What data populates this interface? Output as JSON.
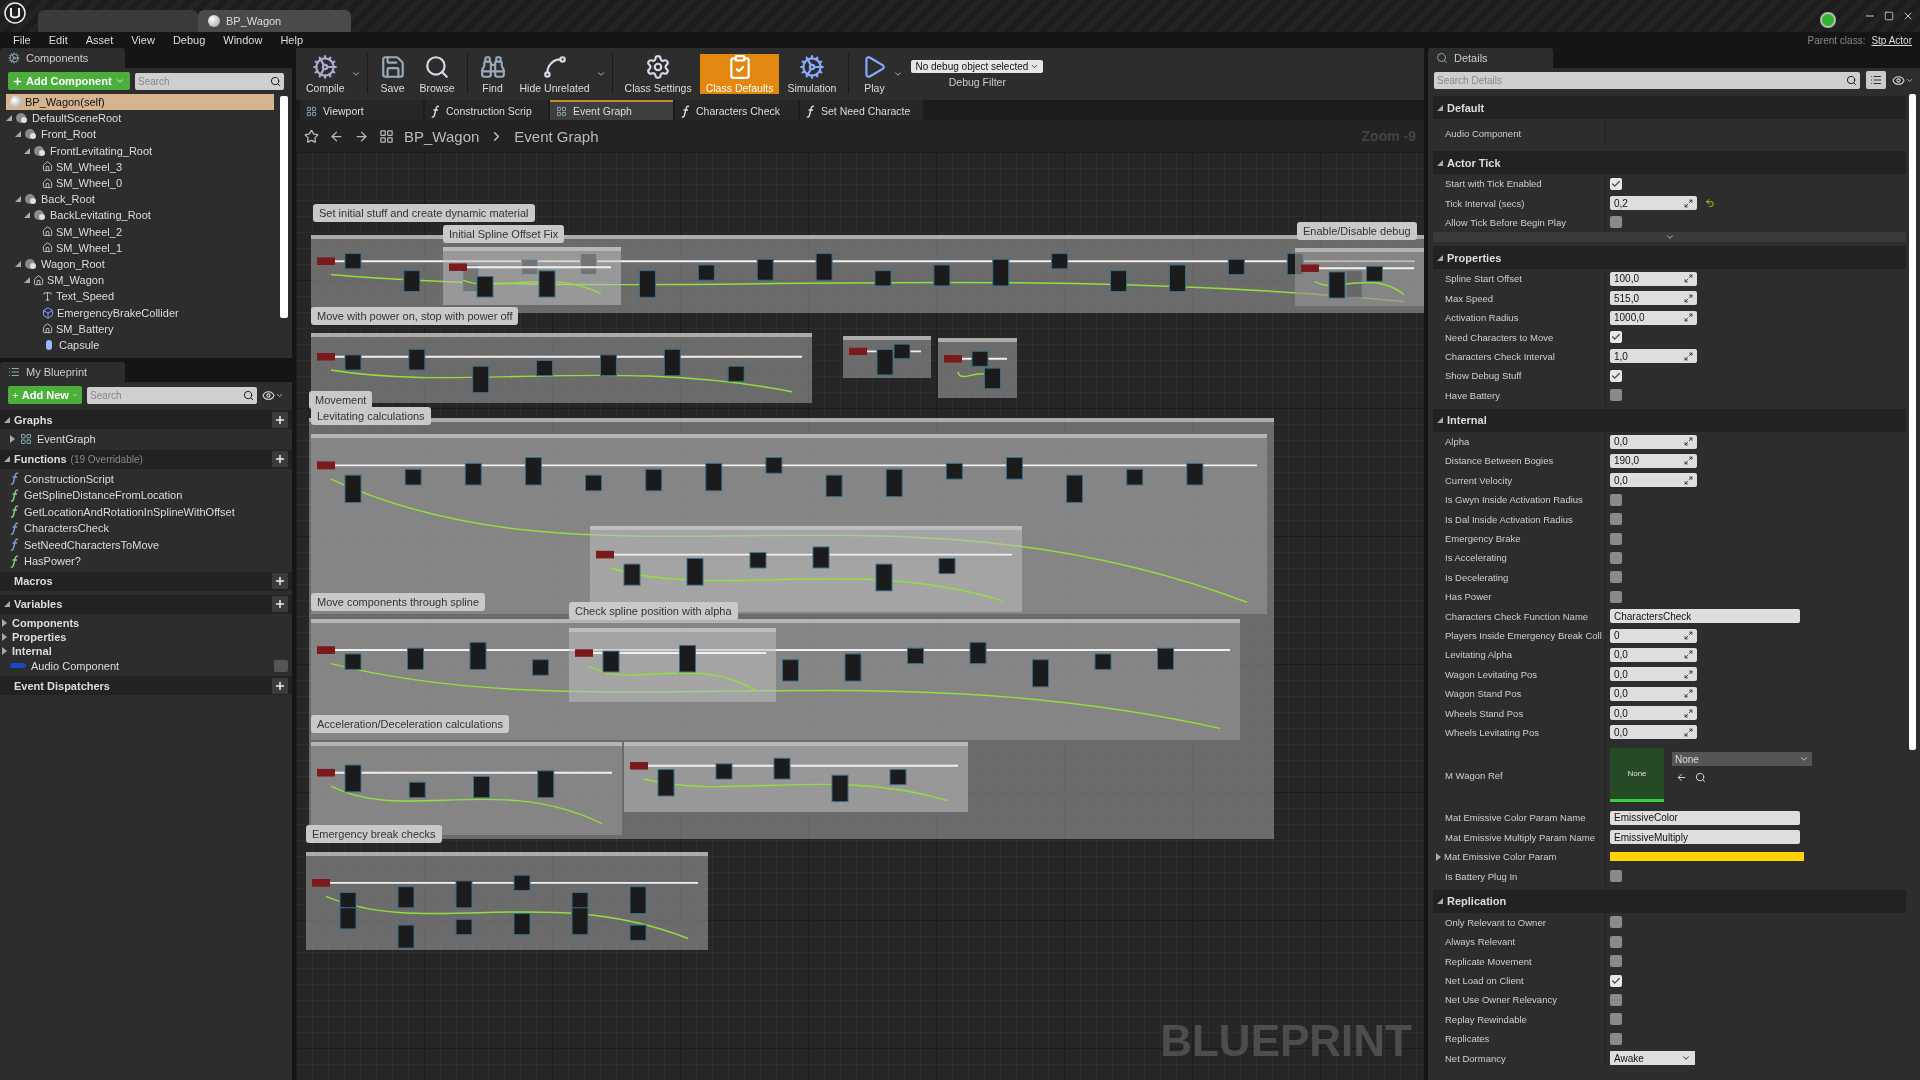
{
  "app_tabs": [
    {
      "label": "BP_Wagon",
      "selected": true
    }
  ],
  "menu": [
    "File",
    "Edit",
    "Asset",
    "View",
    "Debug",
    "Window",
    "Help"
  ],
  "parent_class": {
    "label": "Parent class:",
    "value": "Stp Actor"
  },
  "components_panel": {
    "title": "Components",
    "add_button": "Add Component",
    "search_placeholder": "Search",
    "tree": [
      {
        "label": "BP_Wagon(self)",
        "kind": "actor",
        "selected": true
      },
      {
        "label": "DefaultSceneRoot",
        "kind": "scene",
        "selected": false,
        "children": [
          {
            "label": "Front_Root",
            "kind": "scene",
            "selected": false,
            "children": [
              {
                "label": "FrontLevitating_Root",
                "kind": "scene",
                "selected": false,
                "children": [
                  {
                    "label": "SM_Wheel_3",
                    "kind": "mesh",
                    "selected": false
                  },
                  {
                    "label": "SM_Wheel_0",
                    "kind": "mesh",
                    "selected": false
                  }
                ]
              }
            ]
          },
          {
            "label": "Back_Root",
            "kind": "scene",
            "selected": false,
            "children": [
              {
                "label": "BackLevitating_Root",
                "kind": "scene",
                "selected": false,
                "children": [
                  {
                    "label": "SM_Wheel_2",
                    "kind": "mesh",
                    "selected": false
                  },
                  {
                    "label": "SM_Wheel_1",
                    "kind": "mesh",
                    "selected": false
                  }
                ]
              }
            ]
          },
          {
            "label": "Wagon_Root",
            "kind": "scene",
            "selected": false,
            "children": [
              {
                "label": "SM_Wagon",
                "kind": "mesh",
                "selected": false,
                "children": [
                  {
                    "label": "Text_Speed",
                    "kind": "text",
                    "selected": false
                  },
                  {
                    "label": "EmergencyBrakeCollider",
                    "kind": "collider",
                    "selected": false
                  },
                  {
                    "label": "SM_Battery",
                    "kind": "mesh",
                    "selected": false
                  },
                  {
                    "label": "Capsule",
                    "kind": "capsule",
                    "selected": false
                  }
                ]
              }
            ]
          }
        ]
      }
    ]
  },
  "my_blueprint": {
    "title": "My Blueprint",
    "add_button": "Add New",
    "search_placeholder": "Search",
    "sections": [
      {
        "title": "Graphs",
        "items": [
          {
            "label": "EventGraph",
            "kind": "graph"
          }
        ]
      },
      {
        "title": "Functions",
        "note": "(19 Overridable)",
        "items": [
          {
            "label": "ConstructionScript",
            "kind": "construction",
            "color": "#7f9ce0"
          },
          {
            "label": "GetSplineDistanceFromLocation",
            "kind": "function",
            "color": "#7fd47f"
          },
          {
            "label": "GetLocationAndRotationInSplineWithOffset",
            "kind": "function",
            "color": "#7fd47f"
          },
          {
            "label": "CharactersCheck",
            "kind": "function",
            "color": "#7f9ce0"
          },
          {
            "label": "SetNeedCharactersToMove",
            "kind": "function",
            "color": "#7f9ce0"
          },
          {
            "label": "HasPower?",
            "kind": "function",
            "color": "#7fd47f"
          }
        ]
      },
      {
        "title": "Macros"
      },
      {
        "title": "Variables",
        "items": [
          {
            "label": "Components",
            "kind": "category"
          },
          {
            "label": "Properties",
            "kind": "category"
          },
          {
            "label": "Internal",
            "kind": "category"
          },
          {
            "label": "Audio Component",
            "kind": "variable"
          }
        ]
      },
      {
        "title": "Event Dispatchers"
      }
    ]
  },
  "toolbar": [
    {
      "label": "Compile",
      "kind": "compile",
      "dropdown": true,
      "selected": false
    },
    {
      "label": "Save",
      "kind": "save",
      "dropdown": false,
      "selected": false
    },
    {
      "label": "Browse",
      "kind": "browse",
      "dropdown": false,
      "selected": false
    },
    {
      "label": "Find",
      "kind": "find",
      "dropdown": false,
      "selected": false
    },
    {
      "label": "Hide Unrelated",
      "kind": "hide",
      "dropdown": true,
      "selected": false
    },
    {
      "label": "Class Settings",
      "kind": "settings",
      "dropdown": false,
      "selected": false
    },
    {
      "label": "Class Defaults",
      "kind": "defaults",
      "dropdown": false,
      "selected": true
    },
    {
      "label": "Simulation",
      "kind": "simulation",
      "dropdown": false,
      "selected": false
    },
    {
      "label": "Play",
      "kind": "play",
      "dropdown": true,
      "selected": false
    }
  ],
  "debug_filter": {
    "value": "No debug object selected",
    "label": "Debug Filter"
  },
  "doc_tabs": [
    {
      "label": "Viewport",
      "kind": "viewport",
      "selected": false
    },
    {
      "label": "Construction Scrip",
      "kind": "function",
      "selected": false
    },
    {
      "label": "Event Graph",
      "kind": "graph",
      "selected": true
    },
    {
      "label": "Characters Check",
      "kind": "function",
      "selected": false
    },
    {
      "label": "Set Need Characte",
      "kind": "function",
      "selected": false
    }
  ],
  "breadcrumb": [
    "BP_Wagon",
    "Event Graph"
  ],
  "zoom": "Zoom -9",
  "comments": [
    {
      "label": "Set initial stuff and create dynamic material"
    },
    {
      "label": "Initial Spline Offset Fix"
    },
    {
      "label": "Enable/Disable debug"
    },
    {
      "label": "Move with power on, stop with power off"
    },
    {
      "label": "Movement"
    },
    {
      "label": "Levitating calculations"
    },
    {
      "label": "Move components through spline"
    },
    {
      "label": "Check spline position with alpha"
    },
    {
      "label": "Acceleration/Deceleration calculations"
    },
    {
      "label": "Emergency break checks"
    }
  ],
  "graph_watermark": "BLUEPRINT",
  "details": {
    "title": "Details",
    "search_placeholder": "Search Details",
    "sections": [
      {
        "title": "Default",
        "advanced": false,
        "rows": [
          {
            "label": "Audio Component",
            "kind": "empty"
          }
        ]
      },
      {
        "title": "Actor Tick",
        "advanced": true,
        "rows": [
          {
            "label": "Start with Tick Enabled",
            "kind": "checkbox",
            "checked": true
          },
          {
            "label": "Tick Interval (secs)",
            "kind": "number",
            "value": "0,2",
            "reset": true
          },
          {
            "label": "Allow Tick Before Begin Play",
            "kind": "checkbox",
            "checked": false
          }
        ]
      },
      {
        "title": "Properties",
        "advanced": false,
        "rows": [
          {
            "label": "Spline Start Offset",
            "kind": "number",
            "value": "100,0"
          },
          {
            "label": "Max Speed",
            "kind": "number",
            "value": "515,0"
          },
          {
            "label": "Activation Radius",
            "kind": "number",
            "value": "1000,0"
          },
          {
            "label": "Need Characters to Move",
            "kind": "checkbox",
            "checked": true
          },
          {
            "label": "Characters Check Interval",
            "kind": "number",
            "value": "1,0"
          },
          {
            "label": "Show Debug Stuff",
            "kind": "checkbox",
            "checked": true
          },
          {
            "label": "Have Battery",
            "kind": "checkbox",
            "checked": false
          }
        ]
      },
      {
        "title": "Internal",
        "advanced": false,
        "rows": [
          {
            "label": "Alpha",
            "kind": "number",
            "value": "0,0"
          },
          {
            "label": "Distance Between Bogies",
            "kind": "number",
            "value": "190,0"
          },
          {
            "label": "Current Velocity",
            "kind": "number",
            "value": "0,0"
          },
          {
            "label": "Is Gwyn Inside Activation Radius",
            "kind": "checkbox",
            "checked": false
          },
          {
            "label": "Is Dal Inside Activation Radius",
            "kind": "checkbox",
            "checked": false
          },
          {
            "label": "Emergency Brake",
            "kind": "checkbox",
            "checked": false
          },
          {
            "label": "Is Accelerating",
            "kind": "checkbox",
            "checked": false
          },
          {
            "label": "Is Decelerating",
            "kind": "checkbox",
            "checked": false
          },
          {
            "label": "Has Power",
            "kind": "checkbox",
            "checked": false
          },
          {
            "label": "Characters Check Function Name",
            "kind": "text",
            "value": "CharactersCheck"
          },
          {
            "label": "Players Inside Emergency Break Coll",
            "kind": "number",
            "value": "0"
          },
          {
            "label": "Levitating Alpha",
            "kind": "number",
            "value": "0,0"
          },
          {
            "label": "Wagon Levitating Pos",
            "kind": "number",
            "value": "0,0"
          },
          {
            "label": "Wagon Stand Pos",
            "kind": "number",
            "value": "0,0"
          },
          {
            "label": "Wheels Stand Pos",
            "kind": "number",
            "value": "0,0"
          },
          {
            "label": "Wheels Levitating Pos",
            "kind": "number",
            "value": "0,0"
          },
          {
            "label": "M Wagon Ref",
            "kind": "asset",
            "thumb": "None",
            "value": "None"
          },
          {
            "label": "Mat Emissive Color Param Name",
            "kind": "text",
            "value": "EmissiveColor"
          },
          {
            "label": "Mat Emissive Multiply Param Name",
            "kind": "text",
            "value": "EmissiveMultiply"
          },
          {
            "label": "Mat Emissive Color Param",
            "kind": "color",
            "color": "#ffd400"
          },
          {
            "label": "Is Battery Plug In",
            "kind": "checkbox",
            "checked": false
          }
        ]
      },
      {
        "title": "Replication",
        "advanced": false,
        "rows": [
          {
            "label": "Only Relevant to Owner",
            "kind": "checkbox",
            "checked": false
          },
          {
            "label": "Always Relevant",
            "kind": "checkbox",
            "checked": false
          },
          {
            "label": "Replicate Movement",
            "kind": "checkbox",
            "checked": false
          },
          {
            "label": "Net Load on Client",
            "kind": "checkbox",
            "checked": true
          },
          {
            "label": "Net Use Owner Relevancy",
            "kind": "checkbox",
            "checked": false
          },
          {
            "label": "Replay Rewindable",
            "kind": "checkbox",
            "checked": false
          },
          {
            "label": "Replicates",
            "kind": "checkbox",
            "checked": false
          },
          {
            "label": "Net Dormancy",
            "kind": "dropdown",
            "value": "Awake"
          }
        ]
      }
    ]
  }
}
